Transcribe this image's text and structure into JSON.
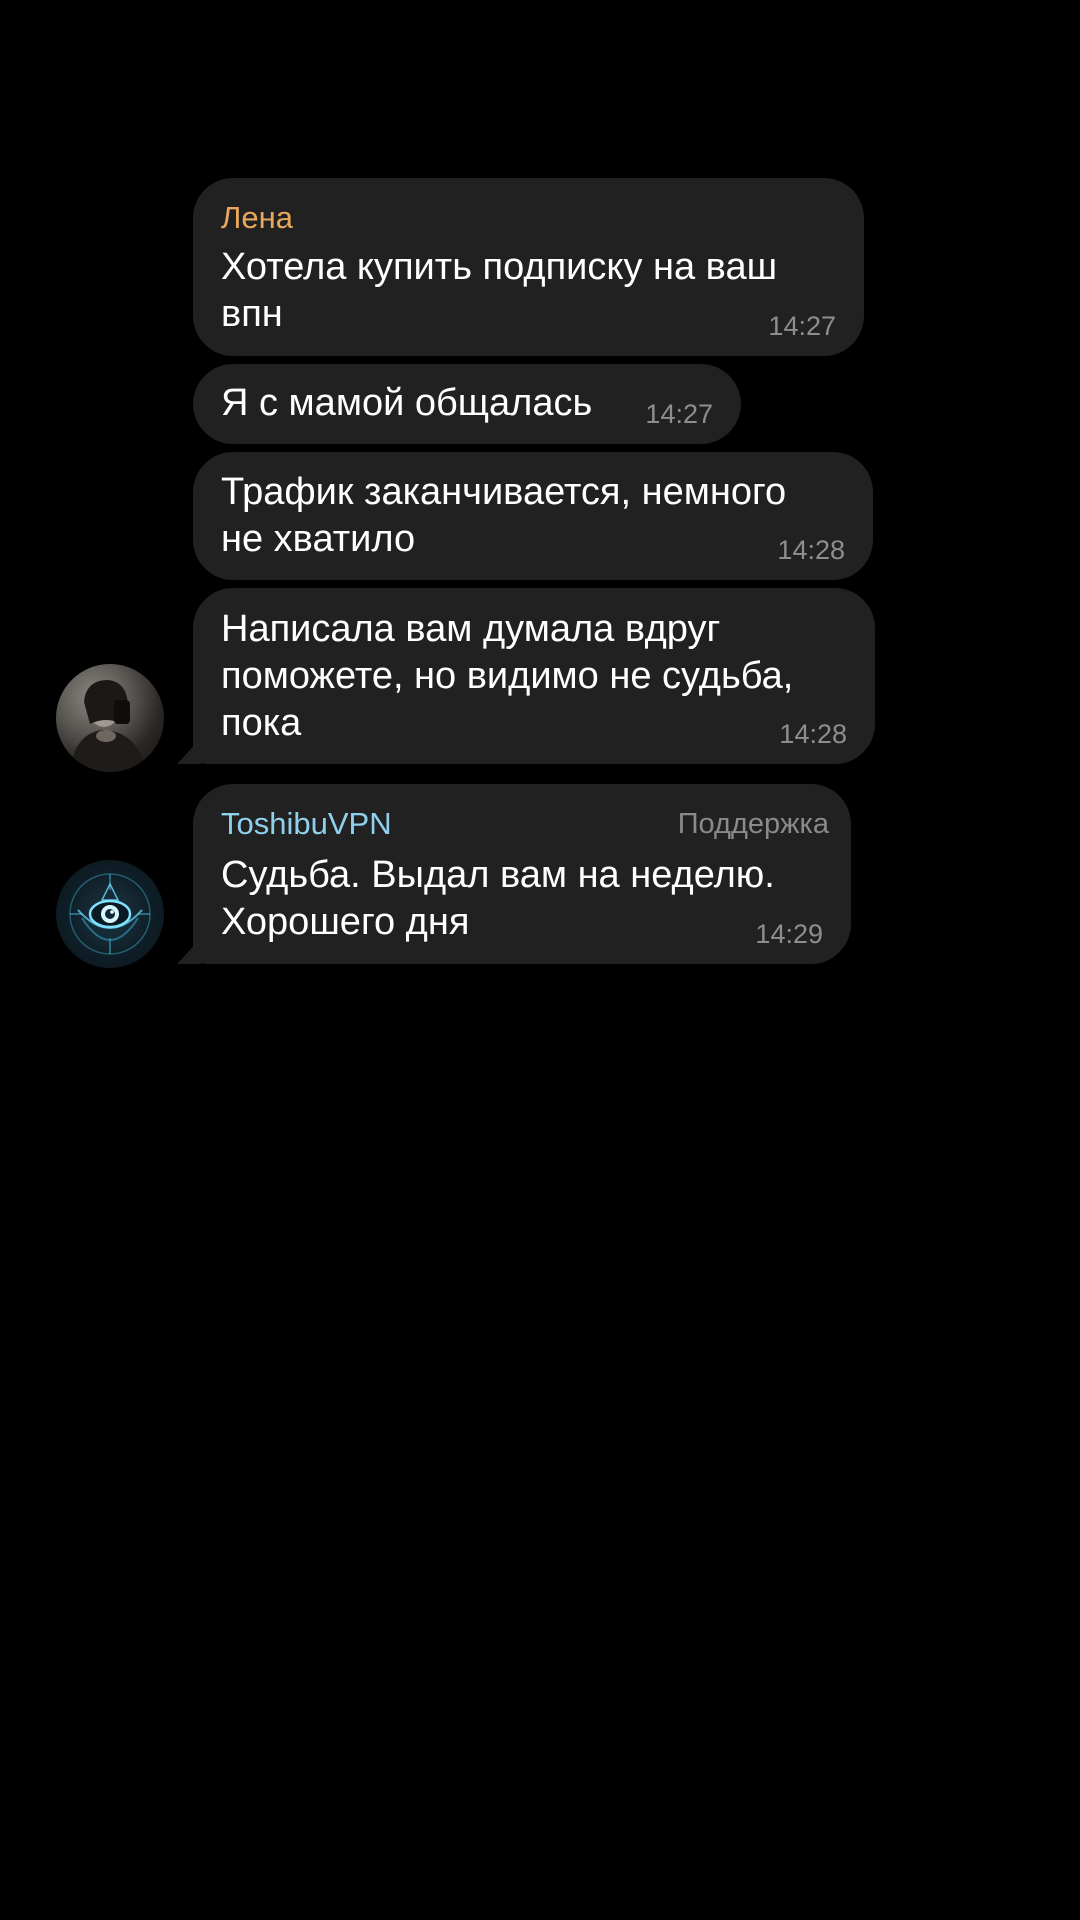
{
  "messages": [
    {
      "sender": "Лена",
      "text": "Хотела купить подписку на ваш\nвпн",
      "time": "14:27"
    },
    {
      "text": "Я с мамой общалась",
      "time": "14:27"
    },
    {
      "text": "Трафик заканчивается, немного\nне хватило",
      "time": "14:28"
    },
    {
      "text": "Написала вам думала вдруг\nпоможете, но видимо не судьба,\nпока",
      "time": "14:28"
    },
    {
      "sender": "ToshibuVPN",
      "role": "Поддержка",
      "text": "Судьба. Выдал вам на неделю.\nХорошего дня",
      "time": "14:29"
    }
  ],
  "colors": {
    "background": "#000000",
    "bubble": "#212121",
    "sender_lena": "#e7a85c",
    "sender_toshibu": "#8fd0ec",
    "time": "#8e8e8e"
  },
  "icons": {
    "lena_avatar": "user-photo-avatar",
    "toshibu_avatar": "eye-logo-avatar"
  }
}
